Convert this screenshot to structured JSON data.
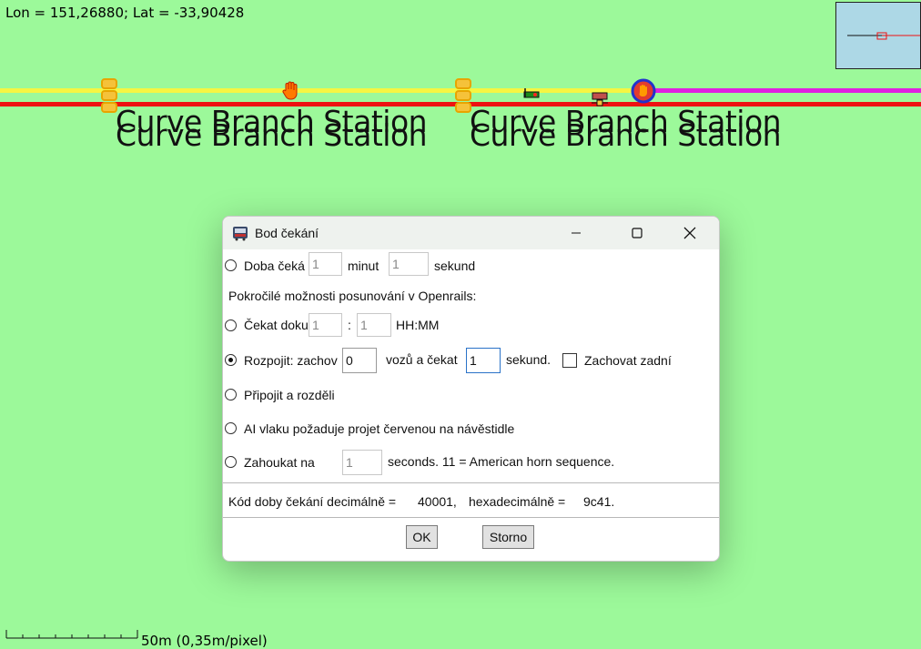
{
  "map": {
    "coords": "Lon = 151,26880; Lat = -33,90428",
    "station_labels": [
      "Curve Branch Station",
      "Curve Branch Station",
      "Curve Branch Station",
      "Curve Branch Station"
    ],
    "scale_label": "50m (0,35m/pixel)",
    "colors": {
      "background": "#9cf99a",
      "track_yellow": "#f5f542",
      "track_red": "#ee1111",
      "track_magenta": "#e020e0",
      "minimap": "#add8e6"
    },
    "icons": [
      "station-marker-icon",
      "stop-hand-icon",
      "signal-icon",
      "junction-icon",
      "wait-point-icon"
    ]
  },
  "dialog": {
    "title": "Bod čekání",
    "icon": "app-icon",
    "rows": {
      "wait_time": {
        "label": "Doba čeká",
        "min_value": "1",
        "min_label": "minut",
        "sec_value": "1",
        "sec_label": "sekund"
      },
      "advanced_heading": "Pokročilé možnosti posunování v Openrails:",
      "wait_until": {
        "label": "Čekat doku",
        "h_value": "1",
        "colon": ":",
        "m_value": "1",
        "format": "HH:MM"
      },
      "uncouple": {
        "label": "Rozpojit: zachov",
        "cars_value": "0",
        "cars_label": "vozů a čekat",
        "wait_value": "1",
        "sec_label": "sekund.",
        "keep_rear_label": "Zachovat zadní"
      },
      "couple_split": {
        "label": "Připojit a rozděli"
      },
      "red_signal": {
        "label": "AI vlaku požaduje projet červenou na návěstidle"
      },
      "horn": {
        "label": "Zahoukat na",
        "value": "1",
        "suffix": "seconds.  11 = American horn sequence."
      }
    },
    "selected_option": "uncouple",
    "code": {
      "label": "Kód doby čekání decimálně =",
      "decimal": "40001,",
      "hex_label": "hexadecimálně =",
      "hex": "9c41."
    },
    "buttons": {
      "ok": "OK",
      "cancel": "Storno"
    }
  }
}
